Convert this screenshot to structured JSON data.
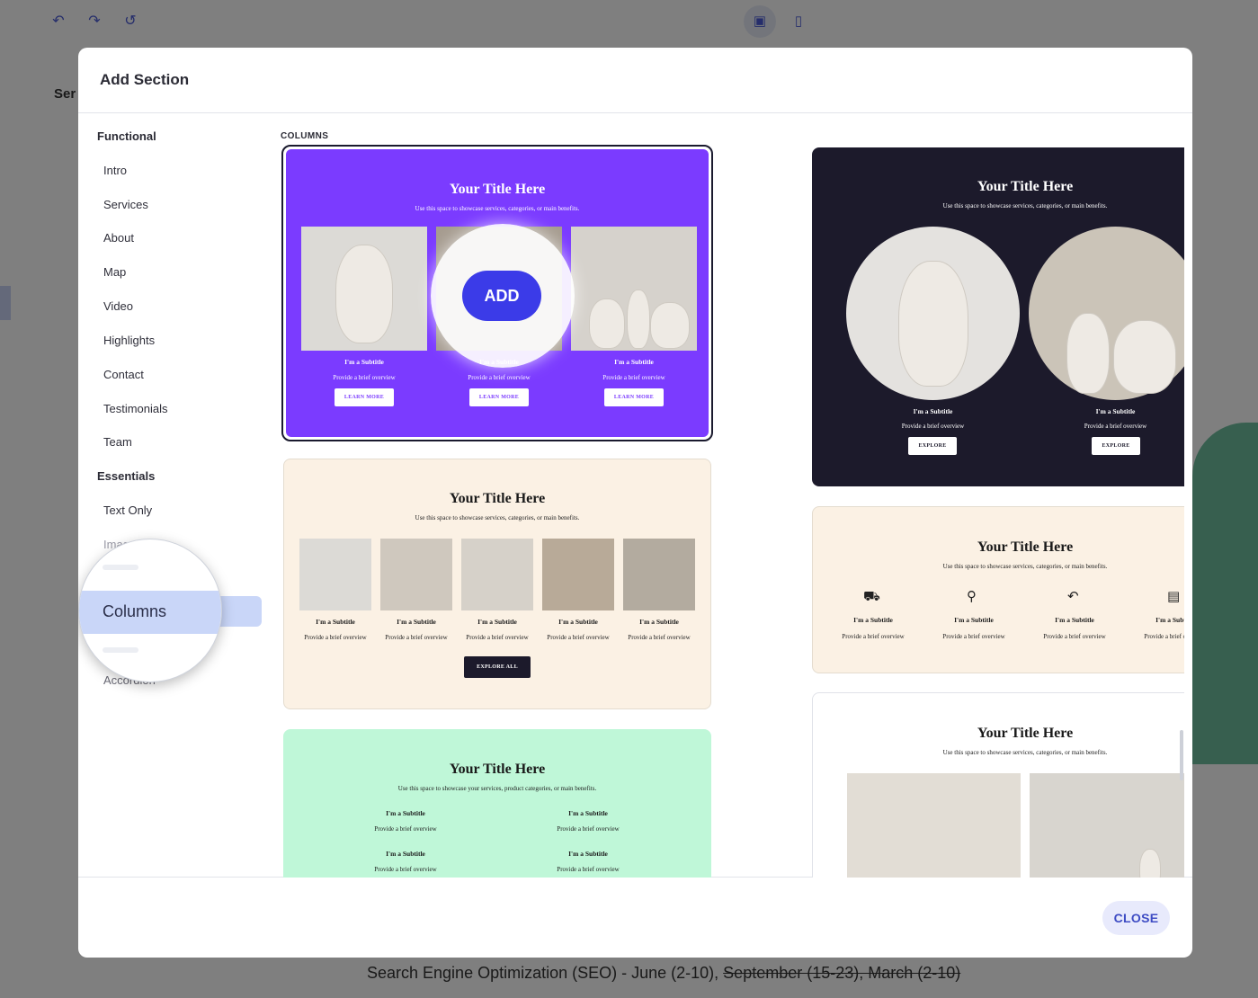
{
  "background": {
    "partial_heading": "Ser",
    "footer_text_plain": "Search Engine Optimization (SEO) - June (2-10), ",
    "footer_text_struck": "September (15-23), March (2-10)",
    "icons": [
      "undo-icon",
      "redo-icon",
      "history-icon",
      "desktop-icon",
      "mobile-icon"
    ]
  },
  "modal": {
    "title": "Add Section",
    "close_label": "CLOSE"
  },
  "sidebar": {
    "groups": [
      {
        "heading": "Functional",
        "items": [
          "Intro",
          "Services",
          "About",
          "Map",
          "Video",
          "Highlights",
          "Contact",
          "Testimonials",
          "Team"
        ]
      },
      {
        "heading": "Essentials",
        "items": [
          "Text Only",
          "Images",
          "Columns",
          "Accordion"
        ]
      }
    ],
    "active_item": "Columns"
  },
  "content": {
    "section_label": "COLUMNS",
    "add_label": "ADD",
    "cards": {
      "c1": {
        "title": "Your Title Here",
        "desc": "Use this space to showcase services, categories, or main benefits.",
        "subtitle": "I'm a Subtitle",
        "overview": "Provide a brief overview",
        "button": "LEARN MORE"
      },
      "c2": {
        "title": "Your Title Here",
        "desc": "Use this space to showcase services, categories, or main benefits.",
        "subtitle": "I'm a Subtitle",
        "overview": "Provide a brief overview",
        "button": "EXPLORE"
      },
      "c3": {
        "title": "Your Title Here",
        "desc": "Use this space to showcase services, categories, or main benefits.",
        "subtitle": "I'm a Subtitle",
        "overview": "Provide a brief overview",
        "button": "EXPLORE ALL"
      },
      "c4": {
        "title": "Your Title Here",
        "desc": "Use this space to showcase services, categories, or main benefits.",
        "subtitle": "I'm a Subtitle",
        "overview": "Provide a brief overview",
        "icons": [
          "truck-icon",
          "location-pin-icon",
          "return-arrow-icon",
          "message-icon"
        ]
      },
      "c5": {
        "title": "Your Title Here",
        "desc": "Use this space to showcase your services, product categories, or main benefits.",
        "subtitle": "I'm a Subtitle",
        "overview": "Provide a brief overview"
      },
      "c6": {
        "title": "Your Title Here",
        "desc": "Use this space to showcase services, categories, or main benefits."
      }
    },
    "colors": {
      "purple": "#7b3bff",
      "dark": "#1c1a2b",
      "cream": "#fbf1e4",
      "mint": "#bff7d8",
      "accent": "#3b3be8"
    }
  }
}
